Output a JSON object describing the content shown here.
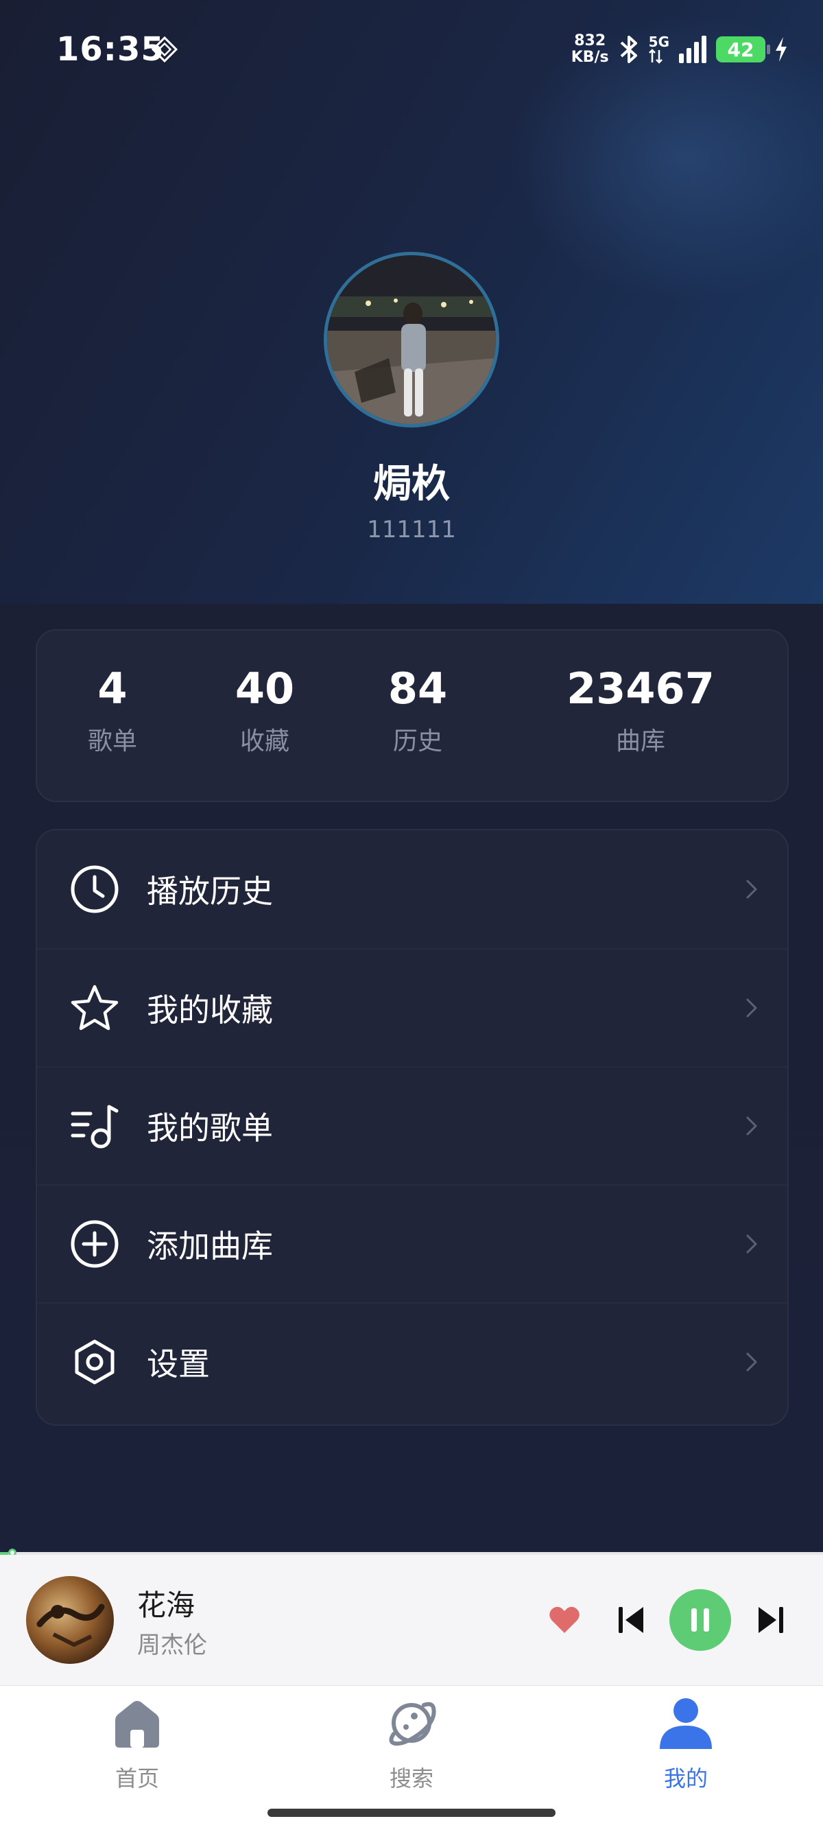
{
  "status_bar": {
    "time": "16:35",
    "net_speed_value": "832",
    "net_speed_unit": "KB/s",
    "network": "5G",
    "battery": "42"
  },
  "profile": {
    "name": "焗杦",
    "id": "111111"
  },
  "stats": [
    {
      "value": "4",
      "label": "歌单"
    },
    {
      "value": "40",
      "label": "收藏"
    },
    {
      "value": "84",
      "label": "历史"
    },
    {
      "value": "23467",
      "label": "曲库"
    }
  ],
  "menu": [
    {
      "label": "播放历史",
      "icon": "clock-icon"
    },
    {
      "label": "我的收藏",
      "icon": "star-icon"
    },
    {
      "label": "我的歌单",
      "icon": "playlist-icon"
    },
    {
      "label": "添加曲库",
      "icon": "plus-circle-icon"
    },
    {
      "label": "设置",
      "icon": "settings-icon"
    }
  ],
  "player": {
    "title": "花海",
    "artist": "周杰伦",
    "progress": 0.01,
    "liked": true,
    "playing": true
  },
  "tabs": [
    {
      "label": "首页",
      "icon": "home-icon",
      "active": false
    },
    {
      "label": "搜索",
      "icon": "planet-icon",
      "active": false
    },
    {
      "label": "我的",
      "icon": "user-icon",
      "active": true
    }
  ],
  "colors": {
    "accent": "#3b74e8",
    "play_green": "#5dcc75",
    "heart": "#e06b6b",
    "background": "#1c2138"
  }
}
